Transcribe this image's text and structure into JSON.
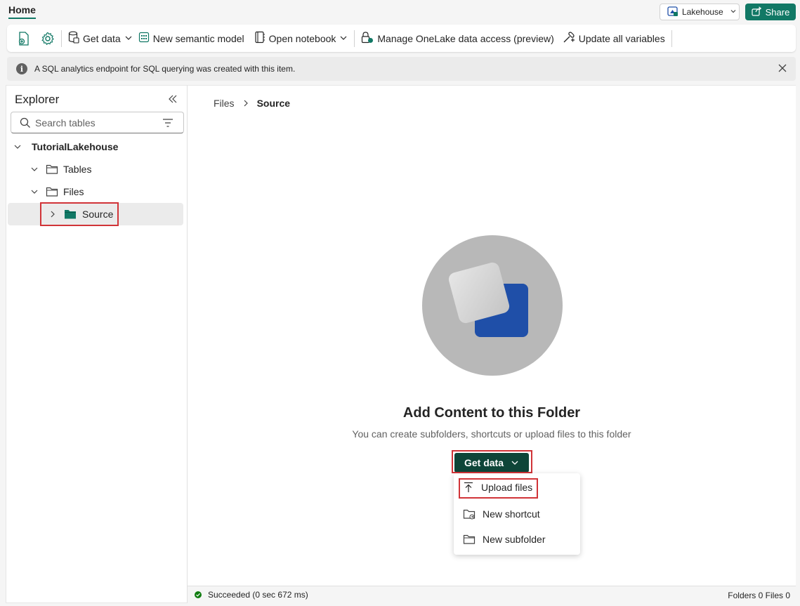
{
  "header": {
    "home_tab": "Home",
    "item_type_button": "Lakehouse",
    "share_button": "Share"
  },
  "ribbon": {
    "get_data": "Get data",
    "new_semantic_model": "New semantic model",
    "open_notebook": "Open notebook",
    "manage_onelake": "Manage OneLake data access (preview)",
    "update_variables": "Update all variables"
  },
  "info_bar": {
    "icon_text": "i",
    "message": "A SQL analytics endpoint for SQL querying was created with this item."
  },
  "explorer": {
    "title": "Explorer",
    "search_placeholder": "Search tables",
    "tree": {
      "root": "TutorialLakehouse",
      "tables": "Tables",
      "files": "Files",
      "source": "Source"
    }
  },
  "main": {
    "breadcrumb": [
      "Files",
      "Source"
    ],
    "empty_title": "Add Content to this Folder",
    "empty_subtitle": "You can create subfolders, shortcuts or upload files to this folder",
    "get_data_button": "Get data",
    "menu": [
      "Upload files",
      "New shortcut",
      "New subfolder"
    ]
  },
  "status": {
    "message": "Succeeded (0 sec 672 ms)",
    "counts": "Folders 0 Files 0"
  },
  "colors": {
    "accent": "#117865",
    "dark_button": "#0e4538",
    "highlight": "#d13438",
    "illustration_blue": "#1f4fa8",
    "illustration_circle": "#b8b8b8"
  }
}
